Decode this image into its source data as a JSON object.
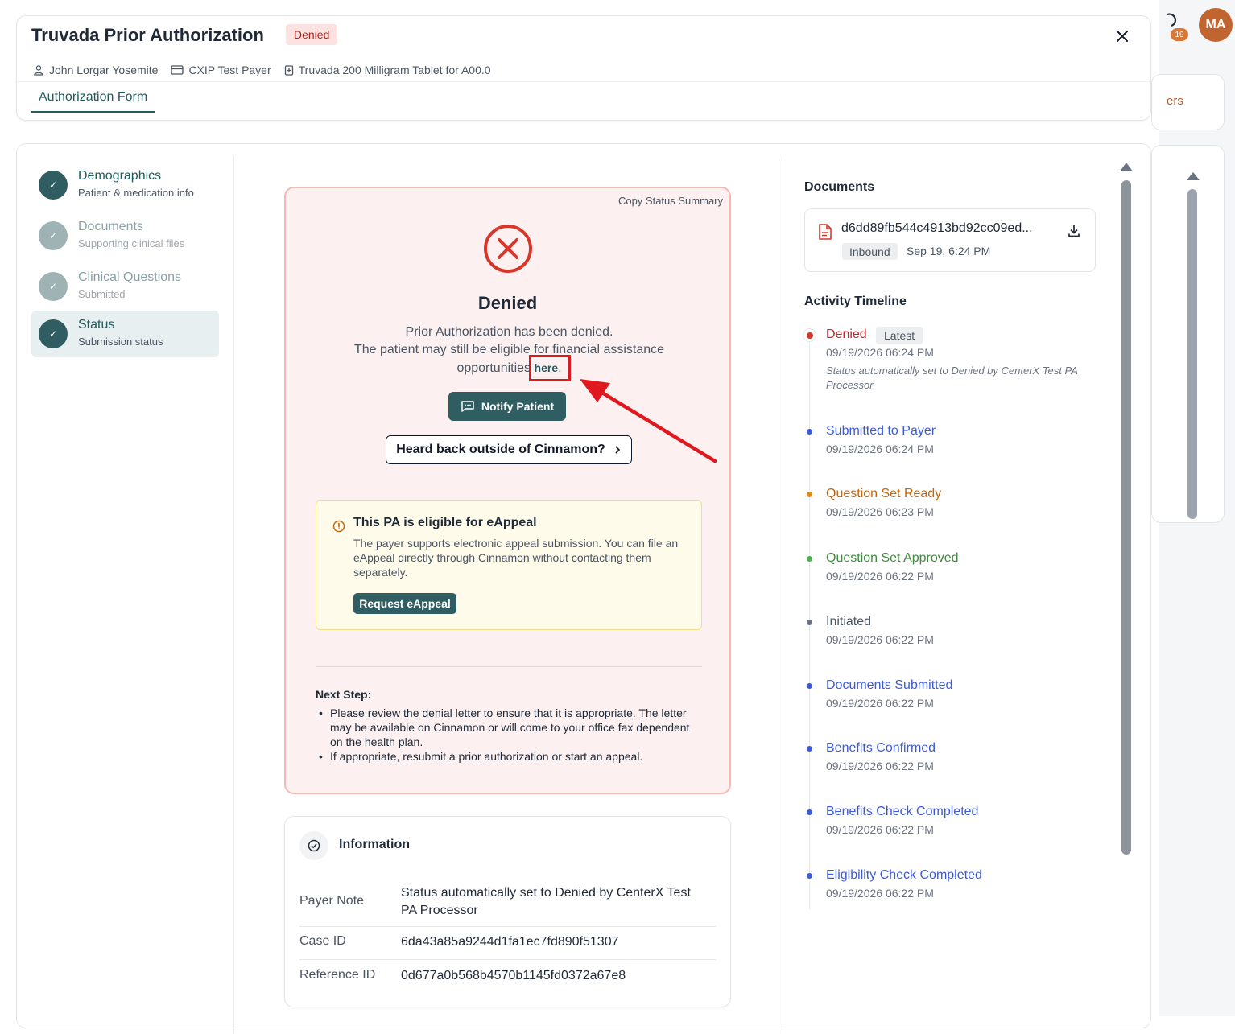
{
  "header": {
    "title": "Truvada Prior Authorization",
    "status": "Denied",
    "patient": "John Lorgar Yosemite",
    "payer": "CXIP Test Payer",
    "medication": "Truvada 200 Milligram Tablet for A00.0",
    "tab": "Authorization Form"
  },
  "topbar": {
    "avatar_initials": "MA",
    "notification_count": "19",
    "background_text": "ers"
  },
  "steps": [
    {
      "title": "Demographics",
      "subtitle": "Patient & medication info",
      "state": "complete"
    },
    {
      "title": "Documents",
      "subtitle": "Supporting clinical files",
      "state": "muted"
    },
    {
      "title": "Clinical Questions",
      "subtitle": "Submitted",
      "state": "muted"
    },
    {
      "title": "Status",
      "subtitle": "Submission status",
      "state": "active"
    }
  ],
  "status_card": {
    "copy_label": "Copy Status Summary",
    "title": "Denied",
    "line1": "Prior Authorization has been denied.",
    "line2": "The patient may still be eligible for financial assistance opportunities",
    "link_text": "here",
    "link_suffix": ".",
    "notify_label": "Notify Patient",
    "heard_label": "Heard back outside of Cinnamon?",
    "eappeal": {
      "title": "This PA is eligible for eAppeal",
      "text": "The payer supports electronic appeal submission. You can file an eAppeal directly through Cinnamon without contacting them separately.",
      "button": "Request eAppeal"
    },
    "next_step_title": "Next Step:",
    "next_steps": [
      "Please review the denial letter to ensure that it is appropriate. The letter may be available on Cinnamon or will come to your office fax dependent on the health plan.",
      "If appropriate, resubmit a prior authorization or start an appeal."
    ]
  },
  "information": {
    "title": "Information",
    "rows": [
      {
        "key": "Payer Note",
        "value": "Status automatically set to Denied by CenterX Test PA Processor"
      },
      {
        "key": "Case ID",
        "value": "6da43a85a9244d1fa1ec7fd890f51307"
      },
      {
        "key": "Reference ID",
        "value": "0d677a0b568b4570b1145fd0372a67e8"
      }
    ]
  },
  "documents": {
    "title": "Documents",
    "file_name": "d6dd89fb544c4913bd92cc09ed...",
    "direction": "Inbound",
    "date": "Sep 19, 6:24 PM"
  },
  "timeline": {
    "title": "Activity Timeline",
    "latest_label": "Latest",
    "items": [
      {
        "label": "Denied",
        "date": "09/19/2026 06:24 PM",
        "note": "Status automatically set to Denied by CenterX Test PA Processor",
        "color": "#c0262d"
      },
      {
        "label": "Submitted to Payer",
        "date": "09/19/2026 06:24 PM",
        "color": "#3b5bd9"
      },
      {
        "label": "Question Set Ready",
        "date": "09/19/2026 06:23 PM",
        "color": "#c2660e"
      },
      {
        "label": "Question Set Approved",
        "date": "09/19/2026 06:22 PM",
        "color": "#3f8a3f"
      },
      {
        "label": "Initiated",
        "date": "09/19/2026 06:22 PM",
        "color": "#4b5563"
      },
      {
        "label": "Documents Submitted",
        "date": "09/19/2026 06:22 PM",
        "color": "#3b5bd9"
      },
      {
        "label": "Benefits Confirmed",
        "date": "09/19/2026 06:22 PM",
        "color": "#3b5bd9"
      },
      {
        "label": "Benefits Check Completed",
        "date": "09/19/2026 06:22 PM",
        "color": "#3b5bd9"
      },
      {
        "label": "Eligibility Check Completed",
        "date": "09/19/2026 06:22 PM",
        "color": "#3b5bd9"
      }
    ]
  },
  "colors": {
    "primary": "#2f5d62",
    "denied": "#d9362b",
    "annotation": "#e0191f"
  }
}
